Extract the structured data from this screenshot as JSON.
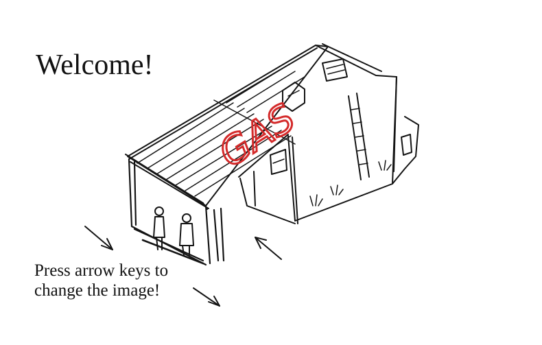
{
  "title": "Welcome!",
  "hint": "Press arrow keys to change the image!",
  "scene": {
    "sign_text": "GAS",
    "sign_color": "#d42a2a",
    "ink_color": "#141414",
    "background": "#ffffff"
  },
  "navigation_arrows": [
    {
      "direction": "up",
      "icon": "arrow-up-left-icon"
    },
    {
      "direction": "left",
      "icon": "arrow-down-right-icon"
    },
    {
      "direction": "down",
      "icon": "arrow-down-right-icon"
    }
  ]
}
